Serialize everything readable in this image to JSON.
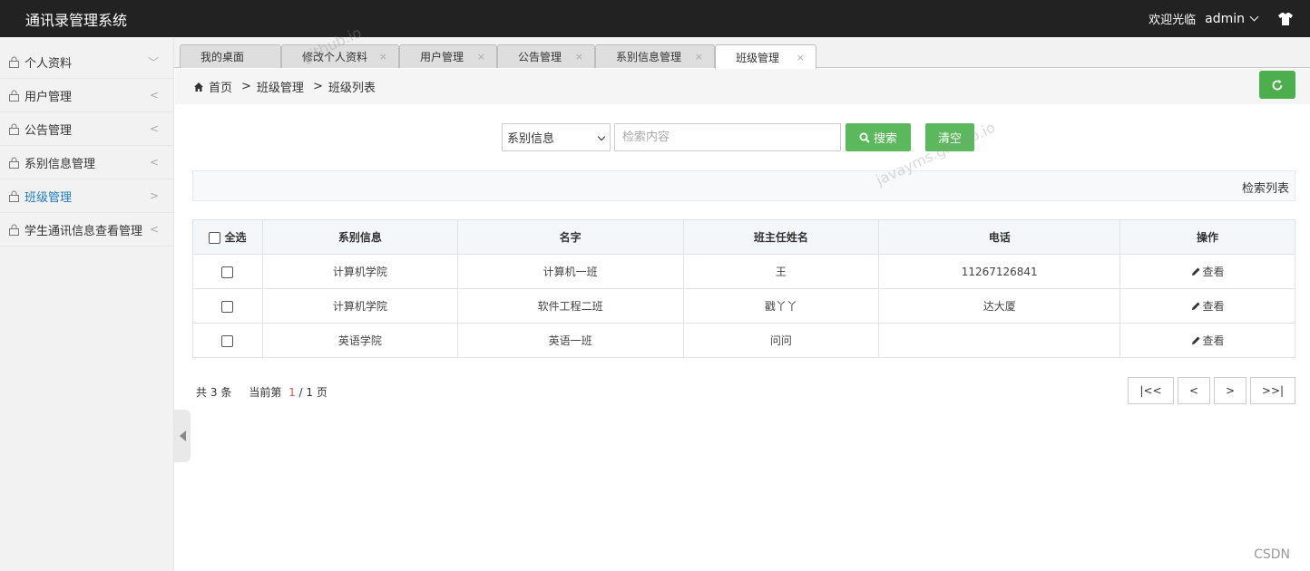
{
  "app": {
    "title": "通讯录管理系统"
  },
  "topbar": {
    "welcome": "欢迎光临",
    "username": "admin"
  },
  "sidebar": {
    "items": [
      {
        "label": "个人资料",
        "arrow": "﹀"
      },
      {
        "label": "用户管理",
        "arrow": "<"
      },
      {
        "label": "公告管理",
        "arrow": "<"
      },
      {
        "label": "系别信息管理",
        "arrow": "<"
      },
      {
        "label": "班级管理",
        "arrow": ">"
      },
      {
        "label": "学生通讯信息查看管理",
        "arrow": "<"
      }
    ]
  },
  "tabs": [
    {
      "label": "我的桌面",
      "close": ""
    },
    {
      "label": "修改个人资料",
      "close": "×"
    },
    {
      "label": "用户管理",
      "close": "×"
    },
    {
      "label": "公告管理",
      "close": "×"
    },
    {
      "label": "系别信息管理",
      "close": "×"
    },
    {
      "label": "班级管理",
      "close": "×"
    }
  ],
  "breadcrumb": {
    "home": "首页",
    "sep": ">",
    "level1": "班级管理",
    "level2": "班级列表"
  },
  "search": {
    "select_value": "系别信息",
    "placeholder": "检索内容",
    "search_label": "搜索",
    "clear_label": "清空"
  },
  "list_panel": {
    "title": "检索列表"
  },
  "table": {
    "select_all": "全选",
    "headers": [
      "系别信息",
      "名字",
      "班主任姓名",
      "电话",
      "操作"
    ],
    "rows": [
      {
        "dept": "计算机学院",
        "name": "计算机一班",
        "teacher": "王",
        "phone": "11267126841",
        "action": "查看"
      },
      {
        "dept": "计算机学院",
        "name": "软件工程二班",
        "teacher": "戳丫丫",
        "phone": "达大厦",
        "action": "查看"
      },
      {
        "dept": "英语学院",
        "name": "英语一班",
        "teacher": "问问",
        "phone": "",
        "action": "查看"
      }
    ]
  },
  "pager": {
    "total_prefix": "共",
    "total": "3",
    "total_suffix": "条",
    "current_prefix": "当前第",
    "current": "1",
    "slash": "/",
    "pages": "1",
    "pages_suffix": "页",
    "first": "|<<",
    "prev": "<",
    "next": ">",
    "last": ">>|"
  },
  "watermarks": {
    "a": "javayms.github.io",
    "b": "github.io"
  },
  "footer": {
    "csdn": "CSDN"
  },
  "colors": {
    "topbar": "#222222",
    "accent_green": "#5cb85c",
    "active_sidebar": "#1e7bbf",
    "current_page": "#d9534f"
  }
}
